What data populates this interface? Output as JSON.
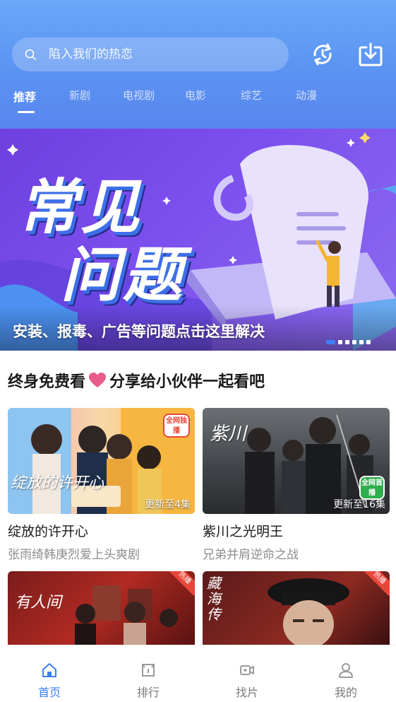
{
  "header": {
    "search": {
      "placeholder": "陷入我们的热恋"
    },
    "history_button_icon": "history-sync-icon",
    "download_button_icon": "download-icon"
  },
  "tabs": [
    {
      "label": "推荐",
      "active": true
    },
    {
      "label": "新剧",
      "active": false
    },
    {
      "label": "电视剧",
      "active": false
    },
    {
      "label": "电影",
      "active": false
    },
    {
      "label": "综艺",
      "active": false
    },
    {
      "label": "动漫",
      "active": false
    }
  ],
  "banner": {
    "title_line1": "常见",
    "title_line2": "问题",
    "caption": "安装、报毒、广告等问题点击这里解决",
    "slide_count": 6,
    "active_slide": 1
  },
  "section": {
    "title_part1": "终身免费看",
    "title_part2": "分享给小伙伴一起看吧"
  },
  "cards": [
    {
      "title": "绽放的许开心",
      "subtitle": "张雨绮韩庚烈爱上头爽剧",
      "update": "更新至4集",
      "thumb_text": "绽放的许开心",
      "badge": "全网独播"
    },
    {
      "title": "紫川之光明王",
      "subtitle": "兄弟并肩逆命之战",
      "update": "更新至16集",
      "thumb_text": "紫川",
      "badge": "全网首播"
    },
    {
      "title": "",
      "subtitle": "",
      "update": "",
      "thumb_text": "有人间",
      "badge": "热播"
    },
    {
      "title": "",
      "subtitle": "",
      "update": "",
      "thumb_text": "藏海传",
      "badge": "热播"
    }
  ],
  "bottom_nav": [
    {
      "label": "首页",
      "icon": "home-icon",
      "active": true
    },
    {
      "label": "排行",
      "icon": "ranking-icon",
      "active": false
    },
    {
      "label": "找片",
      "icon": "video-camera-icon",
      "active": false
    },
    {
      "label": "我的",
      "icon": "user-icon",
      "active": false
    }
  ],
  "colors": {
    "accent": "#3b80f5",
    "header_top": "#6aa8f9",
    "header_bottom": "#5a86ef",
    "banner_purple": "#7c50ee",
    "heart": "#e85b8a"
  }
}
